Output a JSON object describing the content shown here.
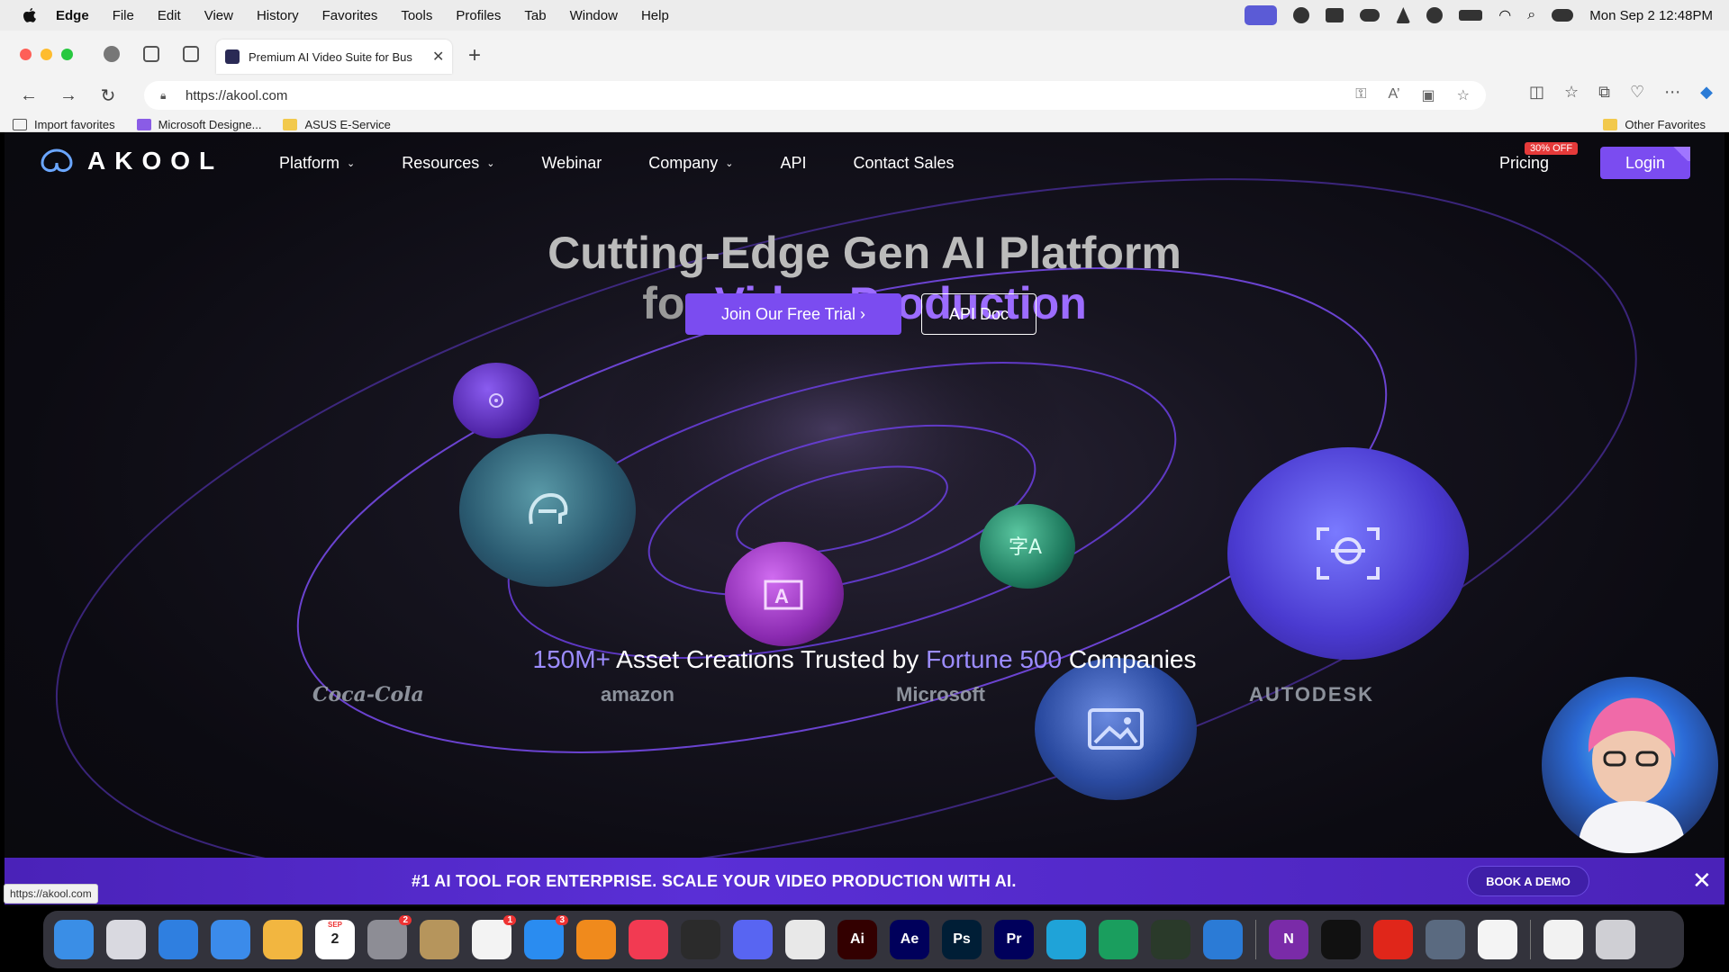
{
  "menubar": {
    "app": "Edge",
    "items": [
      "File",
      "Edit",
      "View",
      "History",
      "Favorites",
      "Tools",
      "Profiles",
      "Tab",
      "Window",
      "Help"
    ],
    "clock": "Mon Sep 2  12:48PM"
  },
  "browser": {
    "tab_title": "Premium AI Video Suite for Bus",
    "url": "https://akool.com",
    "favorites": [
      "Import favorites",
      "Microsoft Designe...",
      "ASUS E-Service"
    ],
    "other_favorites": "Other Favorites"
  },
  "site": {
    "logo_text": "AKOOL",
    "nav": [
      "Platform",
      "Resources",
      "Webinar",
      "Company",
      "API",
      "Contact Sales"
    ],
    "pricing": "Pricing",
    "pricing_badge": "30% OFF",
    "login": "Login",
    "hero_line1": "Cutting-Edge Gen AI Platform",
    "hero_line2_a": "for ",
    "hero_line2_b": "Video Production",
    "cta_trial": "Join Our Free Trial ›",
    "cta_api": "API Doc",
    "stats_a": "150M+",
    "stats_b": " Asset Creations Trusted by ",
    "stats_c": "Fortune 500",
    "stats_d": " Companies",
    "client_logos": [
      "Coca-Cola",
      "amazon",
      "Microsoft",
      "AUTODESK"
    ]
  },
  "banner": {
    "text": "#1 AI TOOL FOR ENTERPRISE. SCALE YOUR VIDEO PRODUCTION WITH AI.",
    "button": "BOOK A DEMO",
    "close": "✕"
  },
  "status_url": "https://akool.com",
  "dock": [
    {
      "name": "Finder",
      "label": "",
      "color": "#3a8ee6"
    },
    {
      "name": "Launchpad",
      "label": "",
      "color": "#d9d9e0"
    },
    {
      "name": "Safari",
      "label": "",
      "color": "#2f7fe0"
    },
    {
      "name": "Mail",
      "label": "",
      "color": "#3b8bea"
    },
    {
      "name": "Photos",
      "label": "",
      "color": "#f2b640"
    },
    {
      "name": "Calendar",
      "label": "2",
      "color": "#ffffff",
      "badge_text": "SEP"
    },
    {
      "name": "System Settings",
      "label": "",
      "color": "#8d8d95",
      "badge": "2"
    },
    {
      "name": "Notes",
      "label": "",
      "color": "#b6955c"
    },
    {
      "name": "Reminders",
      "label": "",
      "color": "#f3f3f3",
      "badge": "1"
    },
    {
      "name": "App Store",
      "label": "",
      "color": "#2a8cf0",
      "badge": "3"
    },
    {
      "name": "VLC",
      "label": "",
      "color": "#f08a1c"
    },
    {
      "name": "Music",
      "label": "",
      "color": "#f23a52"
    },
    {
      "name": "ChatGPT",
      "label": "",
      "color": "#2b2b2b"
    },
    {
      "name": "Discord",
      "label": "",
      "color": "#5865f2"
    },
    {
      "name": "Chrome",
      "label": "",
      "color": "#e8e8e8"
    },
    {
      "name": "Illustrator",
      "label": "Ai",
      "color": "#330000"
    },
    {
      "name": "After Effects",
      "label": "Ae",
      "color": "#00005b"
    },
    {
      "name": "Photoshop",
      "label": "Ps",
      "color": "#001e36"
    },
    {
      "name": "Premiere Pro",
      "label": "Pr",
      "color": "#00005b"
    },
    {
      "name": "Edge",
      "label": "",
      "color": "#1fa3d8"
    },
    {
      "name": "Folder",
      "label": "",
      "color": "#1a9e5e"
    },
    {
      "name": "Activity",
      "label": "",
      "color": "#2a3a2a"
    },
    {
      "name": "VS Code",
      "label": "",
      "color": "#2b7bd6"
    },
    {
      "name": "OneNote",
      "label": "N",
      "color": "#7a2ba8"
    },
    {
      "name": "CapCut",
      "label": "",
      "color": "#111111"
    },
    {
      "name": "Acrobat",
      "label": "",
      "color": "#e0261a"
    },
    {
      "name": "Preview",
      "label": "",
      "color": "#5a6a80"
    },
    {
      "name": "TextEdit",
      "label": "",
      "color": "#f4f4f4"
    },
    {
      "name": "Documents",
      "label": "",
      "color": "#f2f2f2"
    },
    {
      "name": "Trash",
      "label": "",
      "color": "#cfcfd4"
    }
  ],
  "colors": {
    "accent": "#7b4cf0",
    "highlight": "#9c6cff"
  }
}
